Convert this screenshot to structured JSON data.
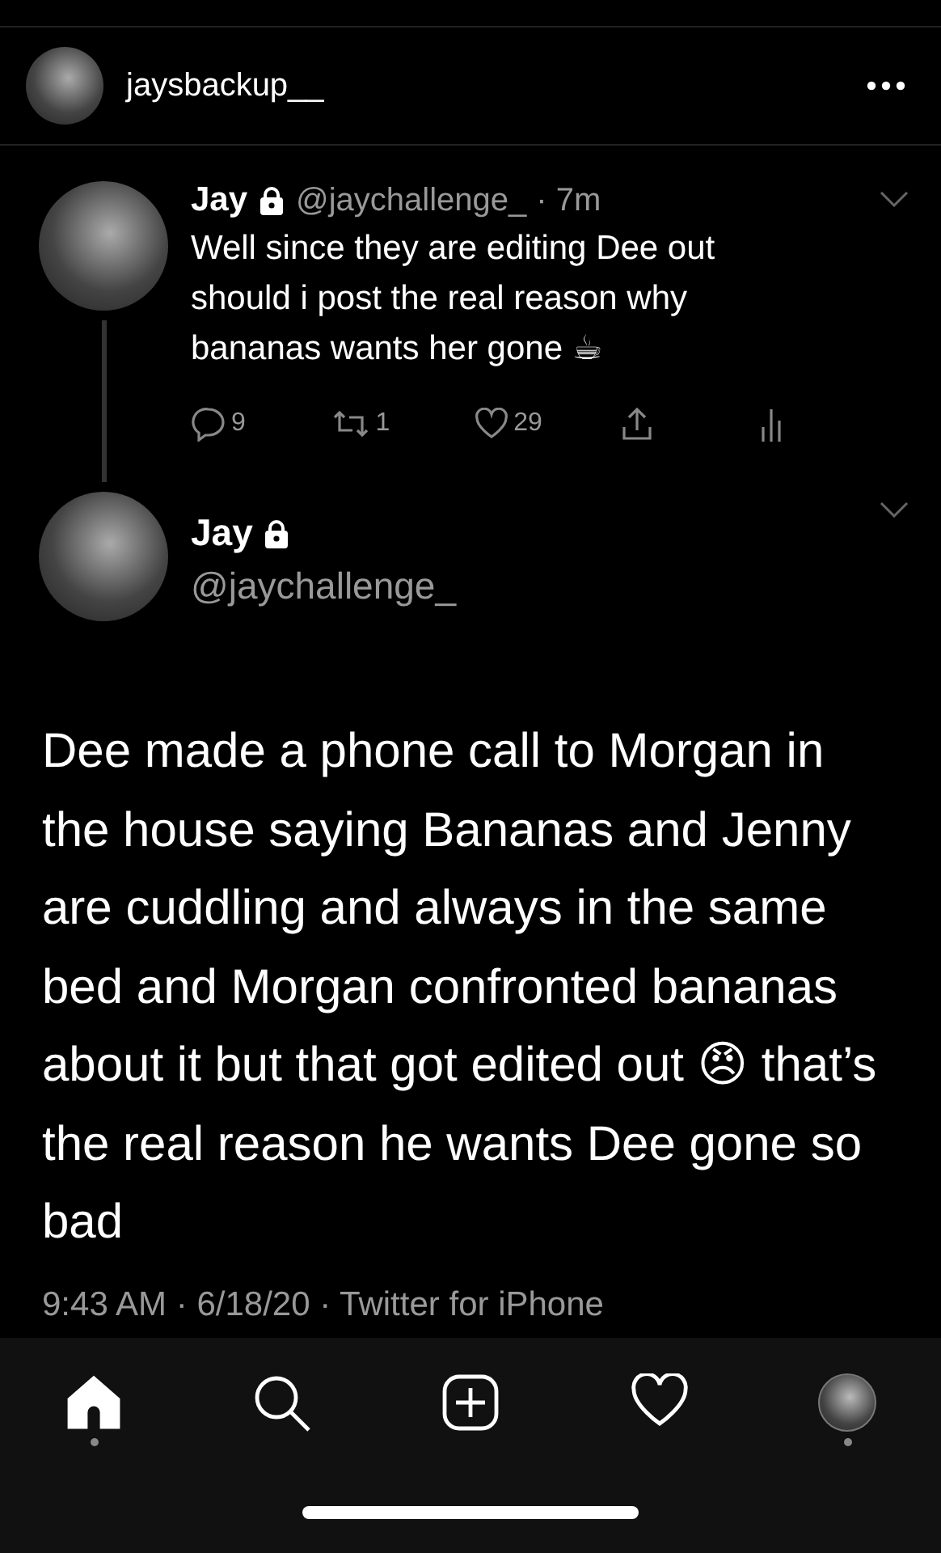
{
  "post_header": {
    "username": "jaysbackup__"
  },
  "parent_tweet": {
    "name": "Jay",
    "handle": "@jaychallenge_",
    "time": "· 7m",
    "protected": true,
    "text": "Well since they are editing Dee out should i post the real reason why bananas wants her gone ☕",
    "actions": [
      {
        "kind": "reply",
        "count": "9"
      },
      {
        "kind": "retweet",
        "count": "1"
      },
      {
        "kind": "like",
        "count": "29"
      },
      {
        "kind": "share"
      },
      {
        "kind": "stats"
      }
    ]
  },
  "main_tweet": {
    "name": "Jay",
    "handle": "@jaychallenge_",
    "protected": true,
    "text": "Dee made a phone call to Morgan in the house saying Bananas and Jenny are cuddling and always in the same bed and Morgan confronted bananas about it but that got edited out 😠 that’s the real reason he wants Dee gone so bad",
    "meta": "9:43 AM · 6/18/20 · Twitter for iPhone"
  },
  "nav": [
    {
      "kind": "home",
      "selected": true,
      "dot": true
    },
    {
      "kind": "search",
      "selected": false,
      "dot": false
    },
    {
      "kind": "add",
      "selected": false,
      "dot": false
    },
    {
      "kind": "activity",
      "selected": false,
      "dot": false
    },
    {
      "kind": "profile",
      "selected": false,
      "dot": true
    }
  ]
}
